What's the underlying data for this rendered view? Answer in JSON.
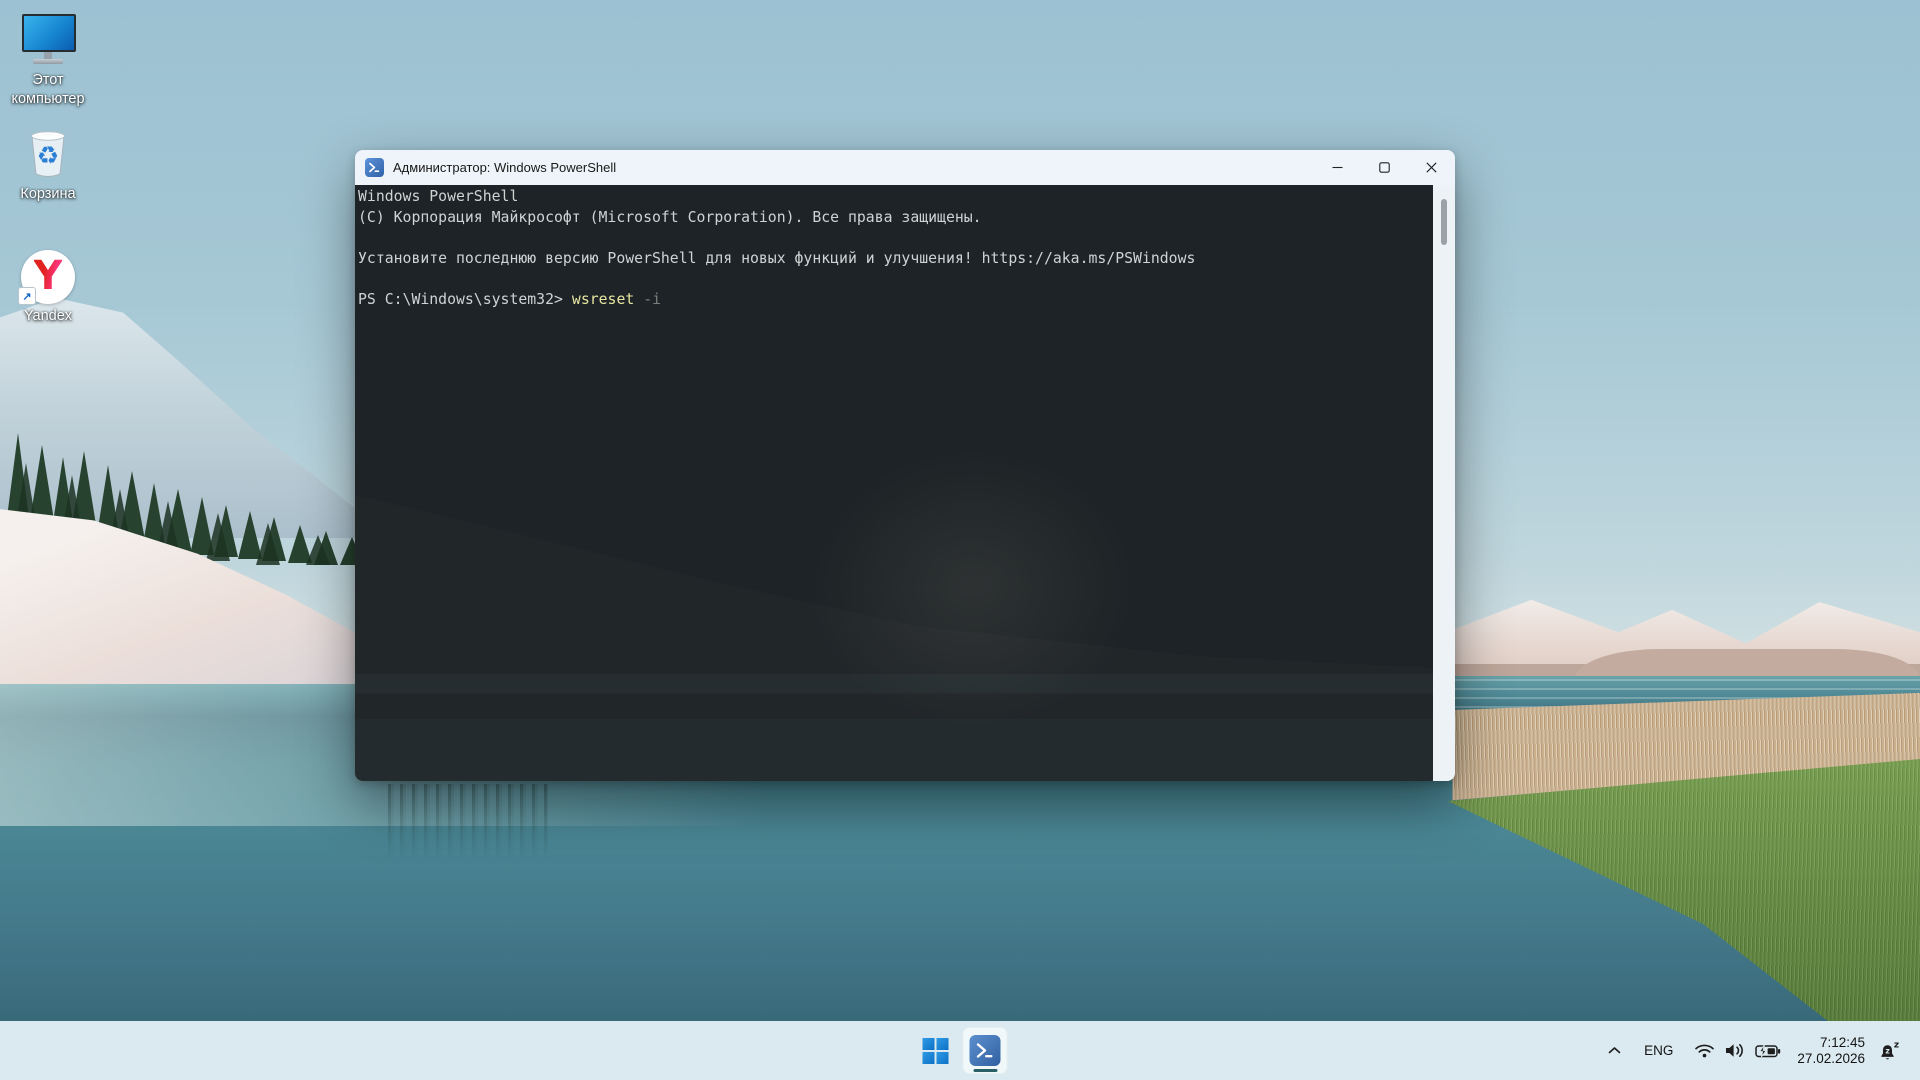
{
  "desktop": {
    "icons": [
      {
        "label": "Этот компьютер"
      },
      {
        "label": "Корзина"
      },
      {
        "label": "Yandex"
      }
    ],
    "yandex_badge_arrow": "↗",
    "recycle_glyph": "♻",
    "yandex_letter": "Y"
  },
  "window": {
    "title": "Администратор: Windows PowerShell",
    "terminal": {
      "lines": [
        "Windows PowerShell",
        "(C) Корпорация Майкрософт (Microsoft Corporation). Все права защищены.",
        "Установите последнюю версию PowerShell для новых функций и улучшения! https://aka.ms/PSWindows"
      ],
      "prompt": "PS C:\\Windows\\system32>",
      "command": "wsreset",
      "suggestion": "-i"
    }
  },
  "taskbar": {
    "tray": {
      "language": "ENG",
      "time": "7:12:45",
      "date": "27.02.2026"
    }
  },
  "colors": {
    "taskbar_bg": "#dbeaf0",
    "titlebar_bg": "#eef4f9",
    "terminal_bg": "#1d2326",
    "terminal_text": "#d0d3d4",
    "command_text": "#e8e6a2",
    "suggestion_text": "#7b7e7e",
    "start_blue": "#1583d6",
    "powershell_blue": "#31609f"
  }
}
